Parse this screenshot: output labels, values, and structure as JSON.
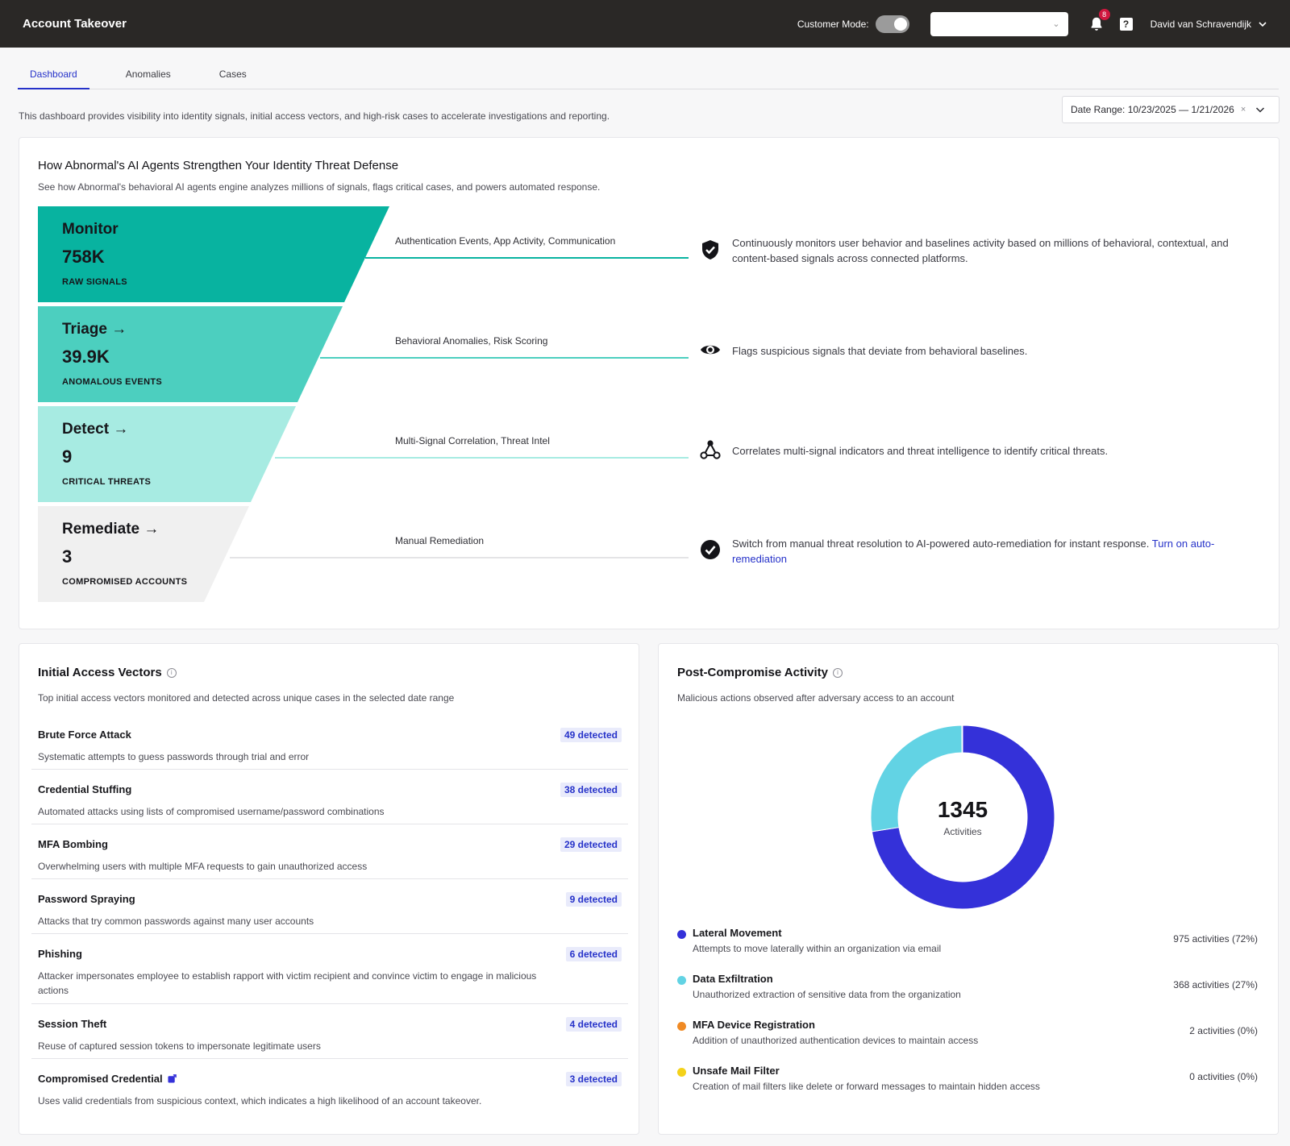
{
  "header": {
    "app_title": "Account Takeover",
    "customer_mode_label": "Customer Mode:",
    "notification_count": "8",
    "help_glyph": "?",
    "user_name": "David van Schravendijk"
  },
  "tabs": [
    {
      "label": "Dashboard",
      "active": true
    },
    {
      "label": "Anomalies",
      "active": false
    },
    {
      "label": "Cases",
      "active": false
    }
  ],
  "intro": "This dashboard provides visibility into identity signals, initial access vectors, and high-risk cases to accelerate investigations and reporting.",
  "date_range": {
    "label": "Date Range: 10/23/2025 — 1/21/2026",
    "clear_glyph": "×"
  },
  "funnel_panel": {
    "title": "How Abnormal's AI Agents Strengthen Your Identity Threat Defense",
    "subtitle": "See how Abnormal's behavioral AI agents engine analyzes millions of signals, flags critical cases, and powers automated response.",
    "colors": [
      "#08b3a0",
      "#4ccfbf",
      "#a7ebe2",
      "#f0f0f0"
    ],
    "stages": [
      {
        "name": "Monitor",
        "value": "758K",
        "caption": "RAW SIGNALS",
        "flow_label": "Authentication Events, App Activity, Communication",
        "icon": "shield-check-icon",
        "description": "Continuously monitors user behavior and baselines activity based on millions of behavioral, contextual, and content-based signals across connected platforms."
      },
      {
        "name": "Triage →",
        "value": "39.9K",
        "caption": "ANOMALOUS EVENTS",
        "flow_label": "Behavioral Anomalies, Risk Scoring",
        "icon": "eye-icon",
        "description": "Flags suspicious signals that deviate from behavioral baselines."
      },
      {
        "name": "Detect →",
        "value": "9",
        "caption": "CRITICAL THREATS",
        "flow_label": "Multi-Signal Correlation, Threat Intel",
        "icon": "network-icon",
        "description": "Correlates multi-signal indicators and threat intelligence to identify critical threats."
      },
      {
        "name": "Remediate →",
        "value": "3",
        "caption": "COMPROMISED ACCOUNTS",
        "flow_label": "Manual Remediation",
        "icon": "check-circle-icon",
        "description": "Switch from manual threat resolution to AI-powered auto-remediation for instant response.",
        "link": "Turn on auto-remediation"
      }
    ]
  },
  "vectors_panel": {
    "title": "Initial Access Vectors",
    "subtitle": "Top initial access vectors monitored and detected across unique cases in the selected date range",
    "items": [
      {
        "name": "Brute Force Attack",
        "badge": "49 detected",
        "description": "Systematic attempts to guess passwords through trial and error"
      },
      {
        "name": "Credential Stuffing",
        "badge": "38 detected",
        "description": "Automated attacks using lists of compromised username/password combinations"
      },
      {
        "name": "MFA Bombing",
        "badge": "29 detected",
        "description": "Overwhelming users with multiple MFA requests to gain unauthorized access"
      },
      {
        "name": "Password Spraying",
        "badge": "9 detected",
        "description": "Attacks that try common passwords against many user accounts"
      },
      {
        "name": "Phishing",
        "badge": "6 detected",
        "description": "Attacker impersonates employee to establish rapport with victim recipient and convince victim to engage in malicious actions"
      },
      {
        "name": "Session Theft",
        "badge": "4 detected",
        "description": "Reuse of captured session tokens to impersonate legitimate users"
      },
      {
        "name": "Compromised Credential",
        "badge": "3 detected",
        "description": "Uses valid credentials from suspicious context, which indicates a high likelihood of an account takeover.",
        "external_link_icon": "external-link-icon"
      }
    ]
  },
  "post_panel": {
    "title": "Post-Compromise Activity",
    "subtitle": "Malicious actions observed after adversary access to an account",
    "total": "1345",
    "total_label": "Activities",
    "legend": [
      {
        "name": "Lateral Movement",
        "description": "Attempts to move laterally within an organization via email",
        "value_text": "975 activities (72%)",
        "color": "#3431d9"
      },
      {
        "name": "Data Exfiltration",
        "description": "Unauthorized extraction of sensitive data from the organization",
        "value_text": "368 activities (27%)",
        "color": "#62d3e4"
      },
      {
        "name": "MFA Device Registration",
        "description": "Addition of unauthorized authentication devices to maintain access",
        "value_text": "2 activities (0%)",
        "color": "#f08a24"
      },
      {
        "name": "Unsafe Mail Filter",
        "description": "Creation of mail filters like delete or forward messages to maintain hidden access",
        "value_text": "0 activities (0%)",
        "color": "#f4d21a"
      }
    ]
  },
  "chart_data": {
    "type": "pie",
    "categories": [
      "Lateral Movement",
      "Data Exfiltration",
      "MFA Device Registration",
      "Unsafe Mail Filter"
    ],
    "values": [
      975,
      368,
      2,
      0
    ],
    "colors": [
      "#3431d9",
      "#62d3e4",
      "#f08a24",
      "#f4d21a"
    ]
  }
}
